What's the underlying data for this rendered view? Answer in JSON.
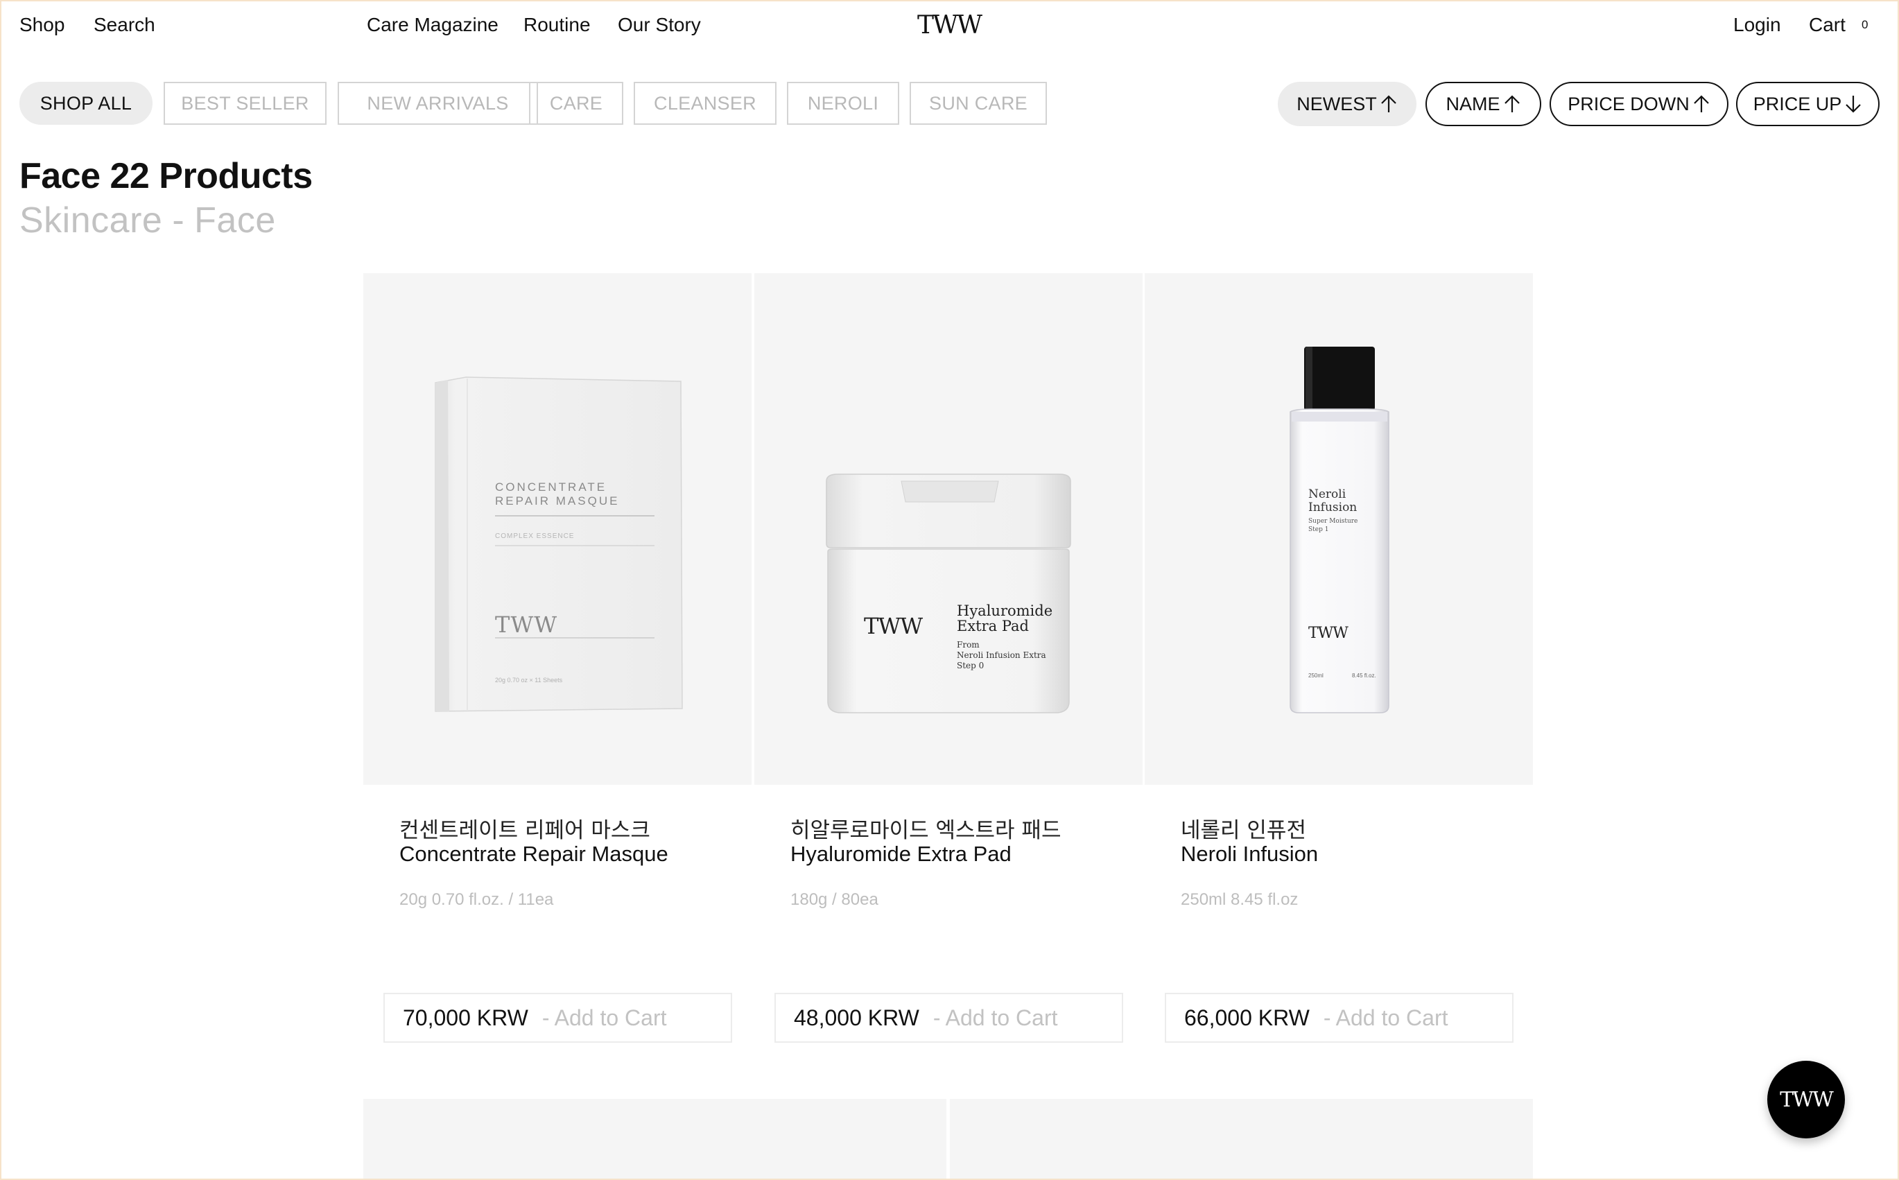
{
  "header": {
    "left_links": [
      "Shop",
      "Search"
    ],
    "center_links": [
      "Care Magazine",
      "Routine",
      "Our Story"
    ],
    "logo": "TWW",
    "login": "Login",
    "cart_label": "Cart",
    "cart_count": "0"
  },
  "filters": {
    "categories": [
      "SHOP ALL",
      "BEST SELLER",
      "NEW ARRIVALS",
      "CARE",
      "CLEANSER",
      "NEROLI",
      "SUN CARE"
    ],
    "active_category": "SHOP ALL",
    "sorts": [
      {
        "label": "NEWEST",
        "arrow": "arrow-up-icon",
        "active": true
      },
      {
        "label": "NAME",
        "arrow": "arrow-up-icon",
        "active": false
      },
      {
        "label": "PRICE DOWN",
        "arrow": "arrow-up-icon",
        "active": false
      },
      {
        "label": "PRICE UP",
        "arrow": "arrow-down-icon",
        "active": false
      }
    ]
  },
  "heading": {
    "title": "Face 22 Products",
    "breadcrumb_parent": "Skincare",
    "breadcrumb_separator": "-",
    "breadcrumb_current": "Face"
  },
  "products": [
    {
      "name_ko": "컨센트레이트 리페어 마스크",
      "name_en": "Concentrate Repair Masque",
      "spec": "20g 0.70 fl.oz. / 11ea",
      "price": "70,000 KRW",
      "add_to_cart": "- Add to Cart",
      "package": {
        "line1": "CONCENTRATE",
        "line2": "REPAIR MASQUE",
        "sub": "COMPLEX ESSENCE",
        "brand": "TWW",
        "foot": "20g 0.70 oz × 11 Sheets"
      }
    },
    {
      "name_ko": "히알루로마이드 엑스트라 패드",
      "name_en": "Hyaluromide Extra Pad",
      "spec": "180g / 80ea",
      "price": "48,000 KRW",
      "add_to_cart": "- Add to Cart",
      "package": {
        "brand": "TWW",
        "line1": "Hyaluromide",
        "line2": "Extra Pad",
        "sub1": "From",
        "sub2": "Neroli Infusion Extra",
        "sub3": "Step 0"
      }
    },
    {
      "name_ko": "네롤리 인퓨전",
      "name_en": "Neroli Infusion",
      "spec": "250ml 8.45 fl.oz",
      "price": "66,000 KRW",
      "add_to_cart": "- Add to Cart",
      "package": {
        "line1": "Neroli",
        "line2": "Infusion",
        "sub1": "Super Moisture",
        "sub2": "Step 1",
        "brand": "TWW",
        "foot_left": "250ml",
        "foot_right": "8.45 fl.oz."
      }
    }
  ],
  "chat_button": {
    "label": "TWW"
  },
  "colors": {
    "muted": "#bdbdbd",
    "tile": "#f5f5f5",
    "active_chip": "#ececec",
    "text": "#111111"
  }
}
